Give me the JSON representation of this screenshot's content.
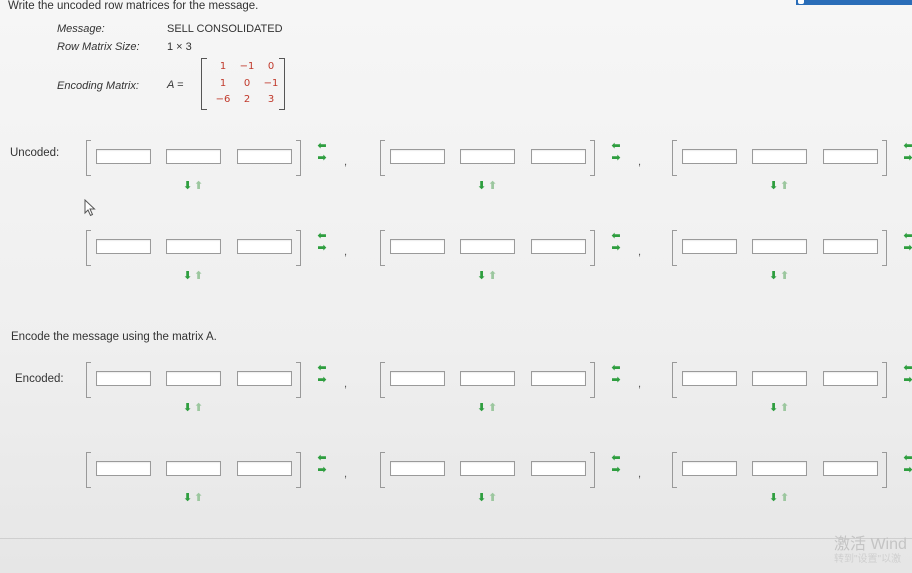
{
  "instructions": {
    "write_uncoded": "Write the uncoded row matrices for the message.",
    "encode": "Encode the message using the matrix A."
  },
  "info": {
    "message_label": "Message:",
    "message_value": "SELL CONSOLIDATED",
    "size_label": "Row Matrix Size:",
    "size_value": "1 × 3",
    "matrix_label": "Encoding Matrix:",
    "matrix_name": "A =",
    "matrix": [
      [
        "1",
        "−1",
        "0"
      ],
      [
        "1",
        "0",
        "−1"
      ],
      [
        "−6",
        "2",
        "3"
      ]
    ]
  },
  "labels": {
    "uncoded": "Uncoded:",
    "encoded": "Encoded:"
  },
  "separator": ",",
  "icons": {
    "arrow_left": "⬅",
    "arrow_right": "➡",
    "arrow_down": "⬇",
    "arrow_up": "⬆"
  },
  "watermark": {
    "line1": "激活 Wind",
    "line2": "转到\"设置\"以激"
  },
  "colors": {
    "arrow_green": "#2e9e3f",
    "matrix_red": "#c0392b",
    "top_bar_blue": "#2a6db8"
  }
}
